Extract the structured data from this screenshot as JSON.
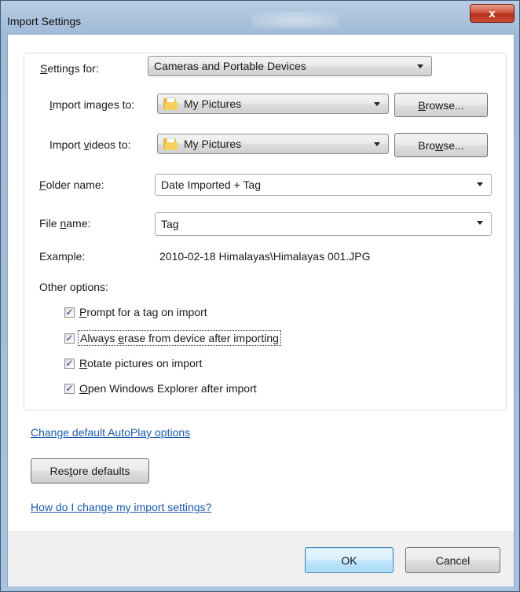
{
  "window": {
    "title": "Import Settings",
    "close_glyph": "x"
  },
  "settings_for": {
    "label_prefix": "",
    "label_u": "S",
    "label_rest": "ettings for:",
    "value": "Cameras and Portable Devices"
  },
  "import_images": {
    "label_pre": "",
    "label_u": "I",
    "label_post": "mport images to:",
    "value": "My Pictures",
    "browse_pre": "",
    "browse_u": "B",
    "browse_post": "rowse..."
  },
  "import_videos": {
    "label_pre": "Import ",
    "label_u": "v",
    "label_post": "ideos to:",
    "value": "My Pictures",
    "browse_pre": "Bro",
    "browse_u": "w",
    "browse_post": "se..."
  },
  "folder_name": {
    "label_pre": "",
    "label_u": "F",
    "label_post": "older name:",
    "value": "Date Imported + Tag"
  },
  "file_name": {
    "label_pre": "File ",
    "label_u": "n",
    "label_post": "ame:",
    "value": "Tag"
  },
  "example": {
    "label": "Example:",
    "value": "2010-02-18 Himalayas\\Himalayas 001.JPG"
  },
  "other_options": {
    "label": "Other options:",
    "items": [
      {
        "pre": "",
        "u": "P",
        "post": "rompt for a tag on import",
        "checked": true
      },
      {
        "pre": "Always ",
        "u": "e",
        "post": "rase from device after importing",
        "checked": true
      },
      {
        "pre": "",
        "u": "R",
        "post": "otate pictures on import",
        "checked": true
      },
      {
        "pre": "",
        "u": "O",
        "post": "pen Windows Explorer after import",
        "checked": true
      }
    ],
    "check_glyph": "✓"
  },
  "links": {
    "autoplay": "Change default AutoPlay options",
    "help": "How do I change my import settings?"
  },
  "restore": {
    "pre": "Res",
    "u": "t",
    "post": "ore defaults"
  },
  "footer": {
    "ok": "OK",
    "cancel": "Cancel"
  },
  "icons": {
    "folder": "folder-icon",
    "dropdown": "chevron-down-icon",
    "close": "close-icon"
  }
}
